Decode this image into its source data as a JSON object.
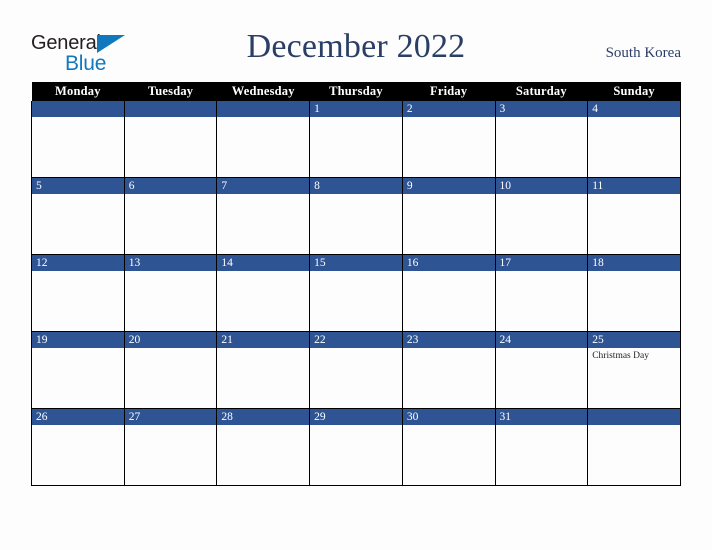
{
  "brand": {
    "name_part1": "General",
    "name_part2": "Blue",
    "triangle_icon": "triangle-icon",
    "colors": {
      "dark": "#231f20",
      "blue": "#1278be"
    }
  },
  "header": {
    "title": "December 2022",
    "country": "South Korea",
    "title_color": "#2b3f66"
  },
  "calendar": {
    "weekday_headers": [
      "Monday",
      "Tuesday",
      "Wednesday",
      "Thursday",
      "Friday",
      "Saturday",
      "Sunday"
    ],
    "header_bg": "#000000",
    "daybar_bg": "#2e5493",
    "cell_bg": "#fdfdfd",
    "weeks": [
      [
        {
          "day": "",
          "events": []
        },
        {
          "day": "",
          "events": []
        },
        {
          "day": "",
          "events": []
        },
        {
          "day": "1",
          "events": []
        },
        {
          "day": "2",
          "events": []
        },
        {
          "day": "3",
          "events": []
        },
        {
          "day": "4",
          "events": []
        }
      ],
      [
        {
          "day": "5",
          "events": []
        },
        {
          "day": "6",
          "events": []
        },
        {
          "day": "7",
          "events": []
        },
        {
          "day": "8",
          "events": []
        },
        {
          "day": "9",
          "events": []
        },
        {
          "day": "10",
          "events": []
        },
        {
          "day": "11",
          "events": []
        }
      ],
      [
        {
          "day": "12",
          "events": []
        },
        {
          "day": "13",
          "events": []
        },
        {
          "day": "14",
          "events": []
        },
        {
          "day": "15",
          "events": []
        },
        {
          "day": "16",
          "events": []
        },
        {
          "day": "17",
          "events": []
        },
        {
          "day": "18",
          "events": []
        }
      ],
      [
        {
          "day": "19",
          "events": []
        },
        {
          "day": "20",
          "events": []
        },
        {
          "day": "21",
          "events": []
        },
        {
          "day": "22",
          "events": []
        },
        {
          "day": "23",
          "events": []
        },
        {
          "day": "24",
          "events": []
        },
        {
          "day": "25",
          "events": [
            "Christmas Day"
          ]
        }
      ],
      [
        {
          "day": "26",
          "events": []
        },
        {
          "day": "27",
          "events": []
        },
        {
          "day": "28",
          "events": []
        },
        {
          "day": "29",
          "events": []
        },
        {
          "day": "30",
          "events": []
        },
        {
          "day": "31",
          "events": []
        },
        {
          "day": "",
          "events": []
        }
      ]
    ]
  }
}
